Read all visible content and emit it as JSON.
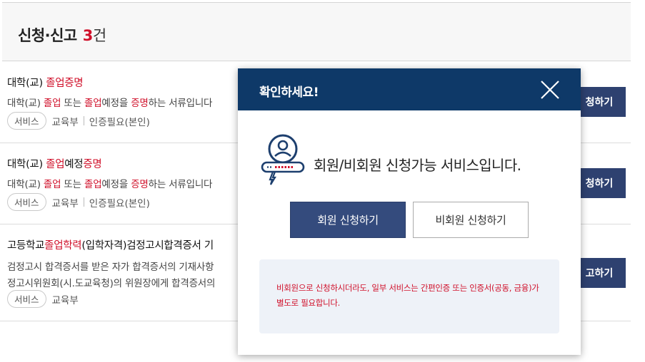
{
  "header": {
    "title": "신청·신고",
    "count": "3",
    "unit": "건"
  },
  "items": [
    {
      "title_parts": [
        {
          "text": "대학(교) ",
          "hl": false
        },
        {
          "text": "졸업증명",
          "hl": true
        }
      ],
      "desc_parts": [
        {
          "text": "대학(교) ",
          "hl": false
        },
        {
          "text": "졸업",
          "hl": true
        },
        {
          "text": " 또는 ",
          "hl": false
        },
        {
          "text": "졸업",
          "hl": true
        },
        {
          "text": "예정을 ",
          "hl": false
        },
        {
          "text": "증명",
          "hl": true
        },
        {
          "text": "하는 서류입니다",
          "hl": false
        }
      ],
      "badge": "서비스",
      "agency": "교육부",
      "auth": "인증필요(본인)",
      "button": "청하기"
    },
    {
      "title_parts": [
        {
          "text": "대학(교) ",
          "hl": false
        },
        {
          "text": "졸업",
          "hl": true
        },
        {
          "text": "예정",
          "hl": false
        },
        {
          "text": "증명",
          "hl": true
        }
      ],
      "desc_parts": [
        {
          "text": "대학(교) ",
          "hl": false
        },
        {
          "text": "졸업",
          "hl": true
        },
        {
          "text": " 또는 ",
          "hl": false
        },
        {
          "text": "졸업",
          "hl": true
        },
        {
          "text": "예정을 ",
          "hl": false
        },
        {
          "text": "증명",
          "hl": true
        },
        {
          "text": "하는 서류입니다",
          "hl": false
        }
      ],
      "badge": "서비스",
      "agency": "교육부",
      "auth": "인증필요(본인)",
      "button": "청하기"
    },
    {
      "title_parts": [
        {
          "text": "고등학교",
          "hl": false
        },
        {
          "text": "졸업학력",
          "hl": true
        },
        {
          "text": "(입학자격)검정고시합격증서 ",
          "hl": false
        },
        {
          "text": "기",
          "hl": false
        }
      ],
      "desc_line1": "검정고시 합격증서를 받은 자가 합격증서의 기재사항",
      "desc_line2": "정고시위원회(시.도교육청)의 위원장에게 합격증서의",
      "badge": "서비스",
      "agency": "교육부",
      "auth": "",
      "button": "고하기"
    }
  ],
  "modal": {
    "title": "확인하세요!",
    "message": "회원/비회원 신청가능 서비스입니다.",
    "member_button": "회원 신청하기",
    "nonmember_button": "비회원 신청하기",
    "notice": "비회원으로 신청하시더라도, 일부 서비스는 간편인증 또는 인증서(공동, 금융)가 별도로 필요합니다.",
    "close_icon": "close-icon",
    "service_icon": "user-id-card-icon"
  },
  "colors": {
    "highlight": "#d0102a",
    "modal_header": "#0e3968",
    "primary_button": "#344b7d",
    "apply_button": "#2e4170"
  }
}
